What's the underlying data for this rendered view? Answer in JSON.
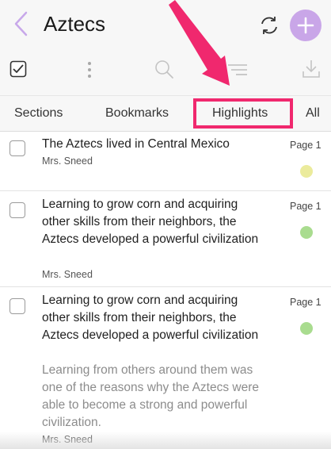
{
  "header": {
    "title": "Aztecs",
    "back_icon": "chevron-left-icon",
    "sync_icon": "sync-icon",
    "add_icon": "plus-icon"
  },
  "toolbar": {
    "icons": [
      "checkbox-icon",
      "more-vertical-icon",
      "search-icon",
      "sort-icon",
      "download-icon"
    ]
  },
  "tabs": {
    "sections": "Sections",
    "bookmarks": "Bookmarks",
    "highlights": "Highlights",
    "all": "All"
  },
  "highlights": [
    {
      "title": "The Aztecs lived in Central Mexico",
      "note": "",
      "author": "Mrs. Sneed",
      "page": "Page 1",
      "color": "#ebeb9c"
    },
    {
      "title": "Learning to grow corn and acquiring other skills from their neighbors, the Aztecs developed a powerful civilization",
      "note": "",
      "author": "Mrs. Sneed",
      "page": "Page 1",
      "color": "#a9dc8f"
    },
    {
      "title": "Learning to grow corn and acquiring other skills from their neighbors, the Aztecs developed a powerful civilization",
      "note": "Learning from others around them was one of the reasons why the Aztecs were able to become a strong and powerful civilization.",
      "author": "Mrs. Sneed",
      "page": "Page 1",
      "color": "#a9dc8f"
    }
  ],
  "colors": {
    "accent": "#c9a6e8",
    "annotation": "#f0286e"
  }
}
